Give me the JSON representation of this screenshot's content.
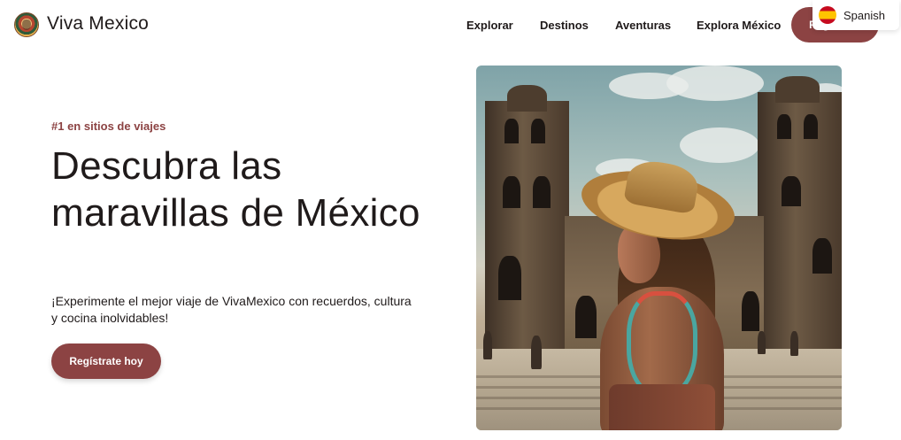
{
  "brand": {
    "name": "Viva Mexico",
    "logo_icon": "mexican-charro-logo-icon"
  },
  "nav": {
    "items": [
      {
        "label": "Explorar"
      },
      {
        "label": "Destinos"
      },
      {
        "label": "Aventuras"
      },
      {
        "label": "Explora México"
      }
    ],
    "cta_label": "Regístrate"
  },
  "language": {
    "label": "Spanish",
    "flag_icon": "spain-flag-icon"
  },
  "hero": {
    "eyebrow": "#1 en sitios de viajes",
    "headline": "Descubra las maravillas de México",
    "subtitle": "¡Experimente el mejor viaje de VivaMexico con recuerdos, cultura y cocina inolvidables!",
    "cta_label": "Regístrate hoy",
    "image_description_icon": "woman-in-sombrero-cathedral-photo"
  },
  "colors": {
    "accent": "#8c4343",
    "text": "#1f1a1a",
    "background": "#ffffff"
  }
}
